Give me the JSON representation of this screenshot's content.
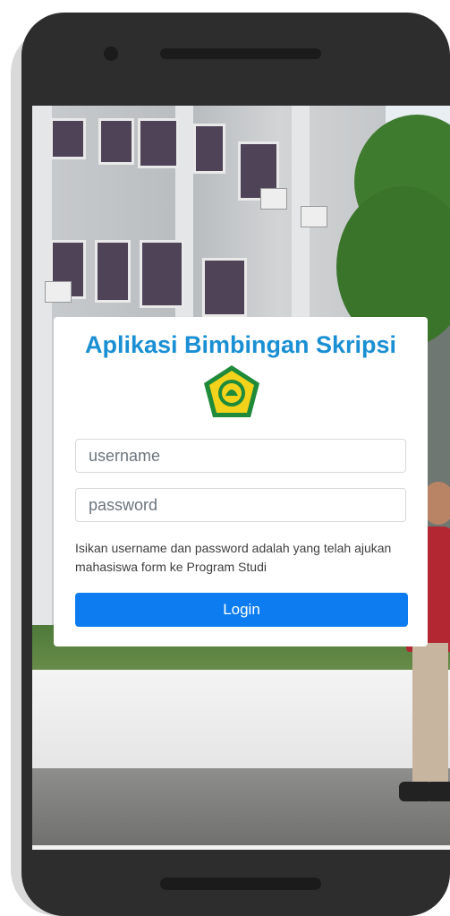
{
  "login": {
    "title": "Aplikasi Bimbingan Skripsi",
    "username_placeholder": "username",
    "password_placeholder": "password",
    "hint": "Isikan username dan password adalah yang telah ajukan mahasiswa form ke Program Studi",
    "button_label": "Login"
  },
  "colors": {
    "title": "#1b8fd3",
    "button": "#0d7cf0",
    "device_frame": "#2d2d2d"
  },
  "icons": {
    "logo": "university-emblem-icon"
  }
}
